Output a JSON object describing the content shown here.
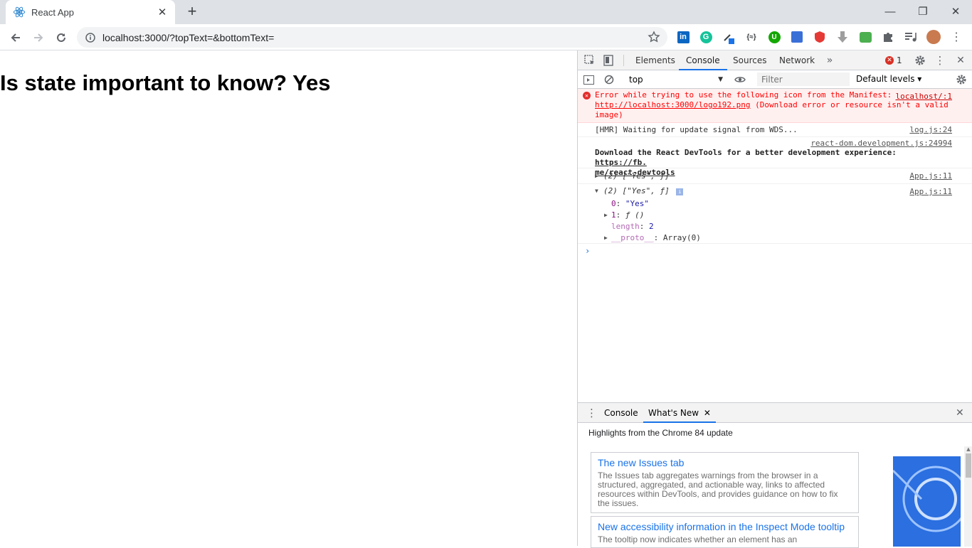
{
  "browser": {
    "tab_title": "React App",
    "url": "localhost:3000/?topText=&bottomText=",
    "extensions": [
      "linkedin-icon",
      "grammarly-icon",
      "eyedropper-icon",
      "json-icon",
      "upwork-icon",
      "calendar-icon",
      "shield-icon",
      "download-icon",
      "inbox-icon",
      "puzzle-icon",
      "media-icon",
      "avatar"
    ]
  },
  "page": {
    "heading": "Is state important to know? Yes"
  },
  "devtools": {
    "tabs": [
      "Elements",
      "Console",
      "Sources",
      "Network"
    ],
    "active_tab": "Console",
    "error_count": "1",
    "context": "top",
    "filter_placeholder": "Filter",
    "levels": "Default levels ▾",
    "console": {
      "error": {
        "text": "Error while trying to use the following icon from the Manifest: ",
        "src": "localhost/:1",
        "link": "http://localhost:3000/logo192.png",
        "tail": " (Download error or resource isn't a valid image)"
      },
      "hmr": {
        "text": "[HMR] Waiting for update signal from WDS...",
        "src": "log.js:24"
      },
      "react_devtools": {
        "src": "react-dom.development.js:24994",
        "text": "Download the React DevTools for a better development experience: ",
        "link1": "https://fb.",
        "link2": "me/react-devtools"
      },
      "arr_collapsed": {
        "text": "(2) [\"Yes\", ƒ]",
        "src": "App.js:11"
      },
      "arr_expanded": {
        "text": "(2) [\"Yes\", ƒ]",
        "src": "App.js:11",
        "items": [
          {
            "key": "0",
            "val": "\"Yes\""
          },
          {
            "key": "1",
            "val": "ƒ ()"
          },
          {
            "key": "length",
            "val": "2"
          },
          {
            "key": "__proto__",
            "val": "Array(0)"
          }
        ]
      }
    },
    "drawer": {
      "tabs": [
        "Console",
        "What's New"
      ],
      "active": "What's New",
      "highlights": "Highlights from the Chrome 84 update",
      "cards": [
        {
          "title": "The new Issues tab",
          "desc": "The Issues tab aggregates warnings from the browser in a structured, aggregated, and actionable way, links to affected resources within DevTools, and provides guidance on how to fix the issues."
        },
        {
          "title": "New accessibility information in the Inspect Mode tooltip",
          "desc": "The tooltip now indicates whether an element has an"
        }
      ]
    }
  }
}
